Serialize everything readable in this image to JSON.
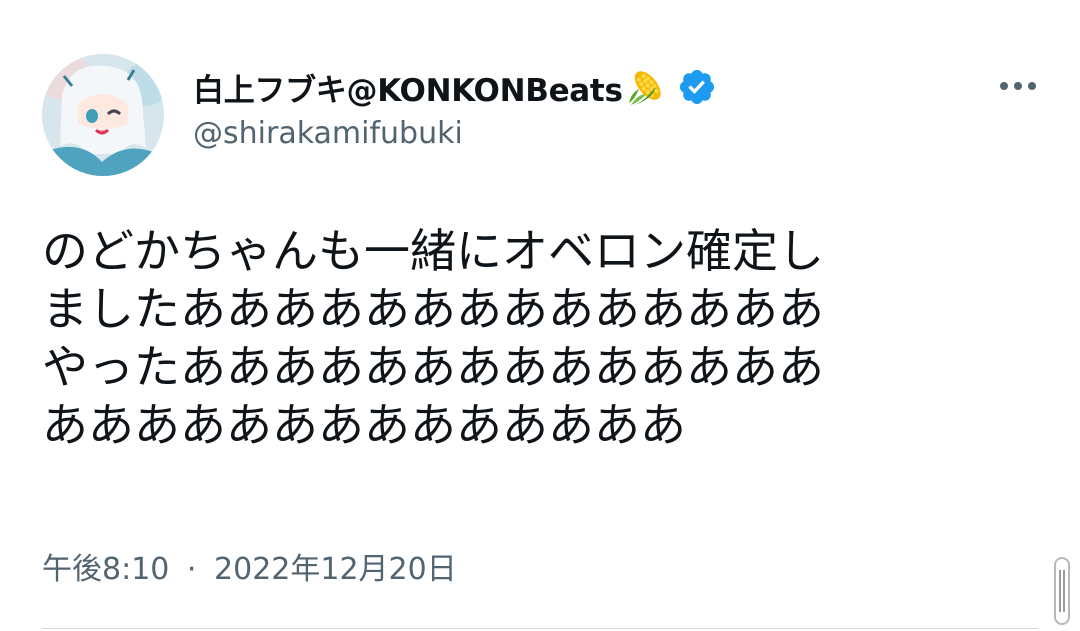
{
  "tweet": {
    "author": {
      "display_name": "白上フブキ@KONKONBeats",
      "handle": "@shirakamifubuki",
      "name_emoji": "corn-icon",
      "verified": true
    },
    "text_lines": [
      "のどかちゃんも一緒にオベロン確定し",
      "ましたああああああああああああああ",
      "やったああああああああああああああ",
      "ああああああああああああああ"
    ],
    "timestamp": {
      "time": "午後8:10",
      "separator": "·",
      "date": "2022年12月20日"
    }
  },
  "colors": {
    "text": "#0f1419",
    "secondary": "#536471",
    "verified": "#1d9bf0",
    "divider": "#cfd9de"
  }
}
